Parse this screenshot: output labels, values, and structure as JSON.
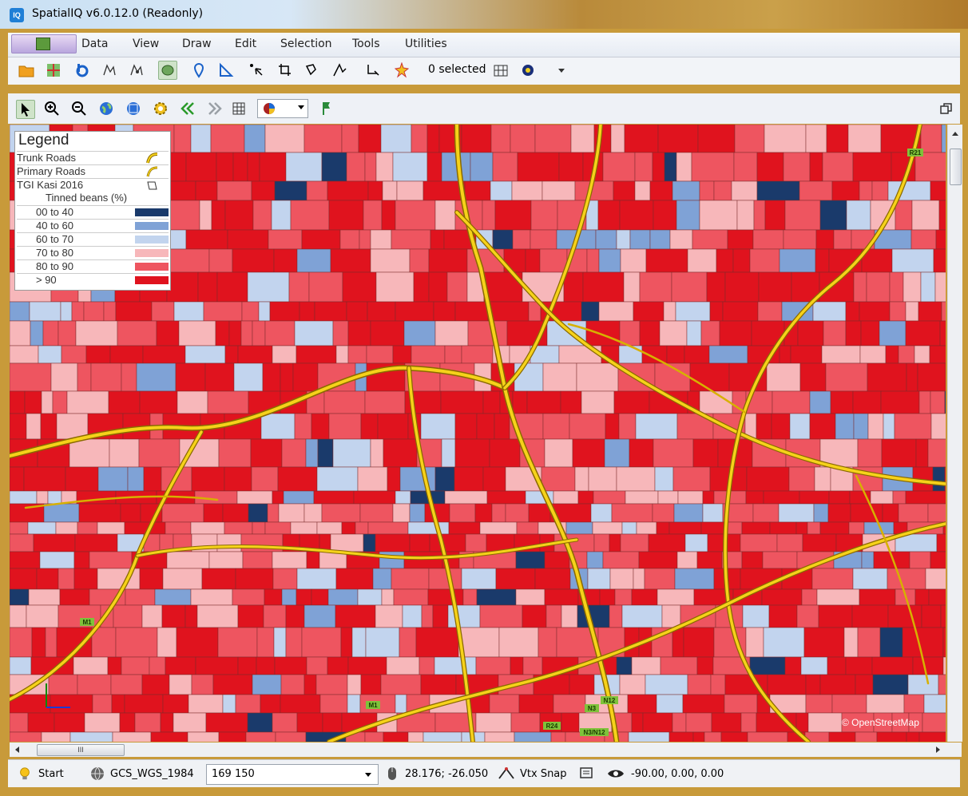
{
  "window": {
    "title": "SpatialIQ v6.0.12.0 (Readonly)",
    "app_icon_text": "IQ"
  },
  "menu": [
    "Data",
    "View",
    "Draw",
    "Edit",
    "Selection",
    "Tools",
    "Utilities"
  ],
  "toolbar": {
    "selected_label": "0 selected"
  },
  "legend": {
    "title": "Legend",
    "layers": [
      "Trunk Roads",
      "Primary Roads",
      "TGI Kasi 2016"
    ],
    "field": "Tinned beans (%)",
    "classes": [
      {
        "label": "00 to 40",
        "color": "#1a3a6b"
      },
      {
        "label": "40 to 60",
        "color": "#7fa2d6"
      },
      {
        "label": "60 to 70",
        "color": "#c2d4ee"
      },
      {
        "label": "70 to 80",
        "color": "#f7b7ba"
      },
      {
        "label": "80 to 90",
        "color": "#ee5560"
      },
      {
        "label": "> 90",
        "color": "#e0131e"
      }
    ]
  },
  "map": {
    "copyright": "© OpenStreetMap",
    "road_labels": [
      "R21",
      "M1",
      "M1",
      "N3",
      "N12",
      "R24",
      "N3/N12"
    ]
  },
  "hscroll_label": "III",
  "status": {
    "start": "Start",
    "crs": "GCS_WGS_1984",
    "scale": "169 150",
    "coords": "28.176; -26.050",
    "snap": "Vtx Snap",
    "view": "-90.00, 0.00, 0.00"
  }
}
